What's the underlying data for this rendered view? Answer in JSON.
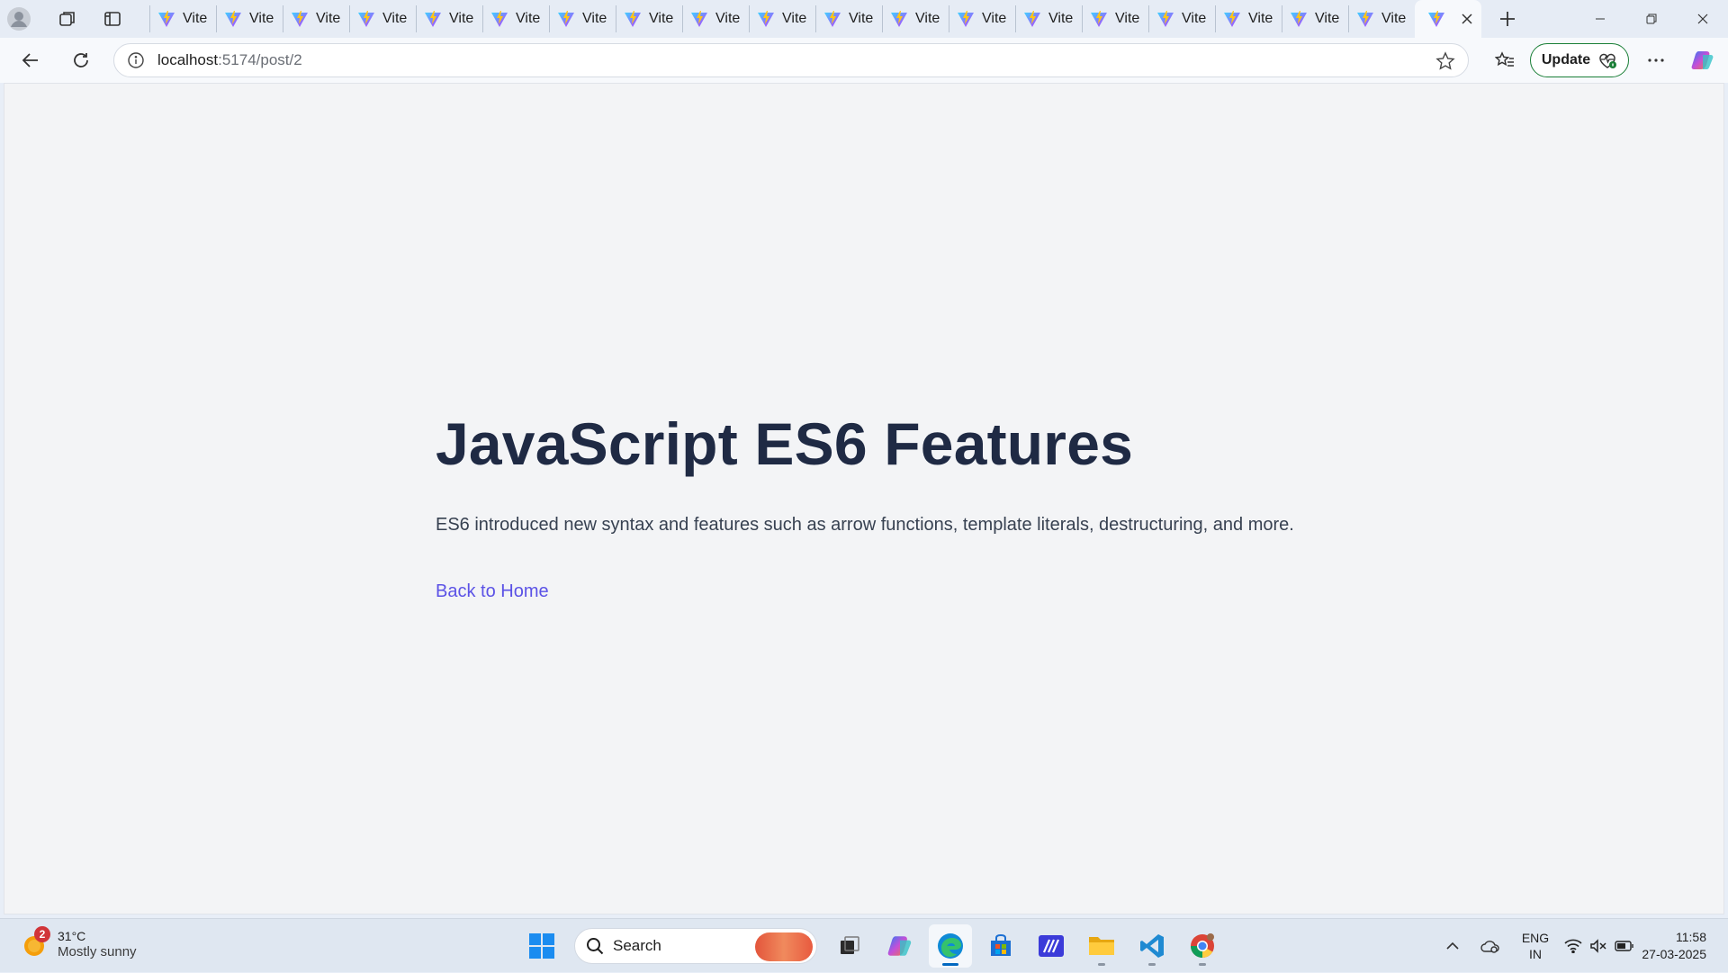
{
  "browser": {
    "tabs": [
      {
        "title": "Vite"
      },
      {
        "title": "Vite"
      },
      {
        "title": "Vite"
      },
      {
        "title": "Vite"
      },
      {
        "title": "Vite"
      },
      {
        "title": "Vite"
      },
      {
        "title": "Vite"
      },
      {
        "title": "Vite"
      },
      {
        "title": "Vite"
      },
      {
        "title": "Vite"
      },
      {
        "title": "Vite"
      },
      {
        "title": "Vite"
      },
      {
        "title": "Vite"
      },
      {
        "title": "Vite"
      },
      {
        "title": "Vite"
      },
      {
        "title": "Vite"
      },
      {
        "title": "Vite"
      },
      {
        "title": "Vite"
      },
      {
        "title": "Vite"
      }
    ],
    "active_tab_icon": "vite-logo-icon",
    "address": {
      "host": "localhost",
      "path": ":5174/post/2"
    },
    "update_label": "Update",
    "accent_color": "#1a7f37"
  },
  "page": {
    "title": "JavaScript ES6 Features",
    "body": "ES6 introduced new syntax and features such as arrow functions, template literals, destructuring, and more.",
    "back_link": "Back to Home",
    "title_color": "#1f2a44",
    "link_color": "#5b52e6"
  },
  "taskbar": {
    "weather": {
      "badge": "2",
      "temperature": "31°C",
      "condition": "Mostly sunny"
    },
    "search_placeholder": "Search",
    "language": {
      "line1": "ENG",
      "line2": "IN"
    },
    "clock": {
      "time": "11:58",
      "date": "27-03-2025"
    }
  }
}
